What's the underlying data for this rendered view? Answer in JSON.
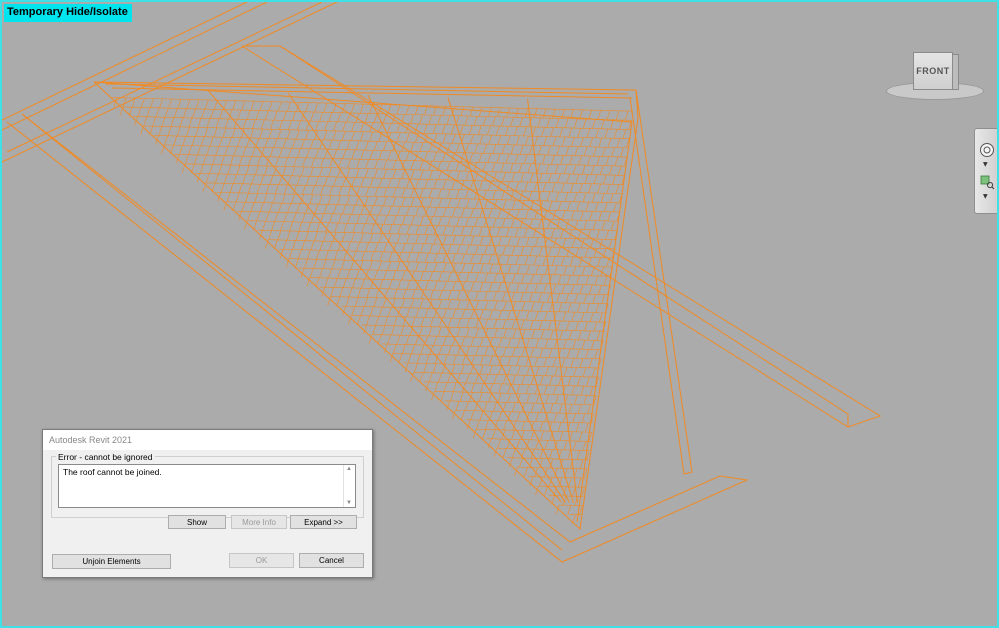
{
  "viewport": {
    "mode_label": "Temporary Hide/Isolate",
    "highlight_color": "#00e4ee",
    "background_color": "#ababab",
    "element_color": "#f08a24"
  },
  "view_cube": {
    "face_label": "FRONT"
  },
  "nav_bar": {
    "icons": [
      "steering-wheel-icon",
      "zoom-icon"
    ]
  },
  "dialog": {
    "title": "Autodesk Revit 2021",
    "group_label": "Error - cannot be ignored",
    "message": "The roof cannot be joined.",
    "buttons": {
      "show": "Show",
      "more_info": "More Info",
      "expand": "Expand >>",
      "unjoin": "Unjoin Elements",
      "ok": "OK",
      "cancel": "Cancel"
    }
  }
}
